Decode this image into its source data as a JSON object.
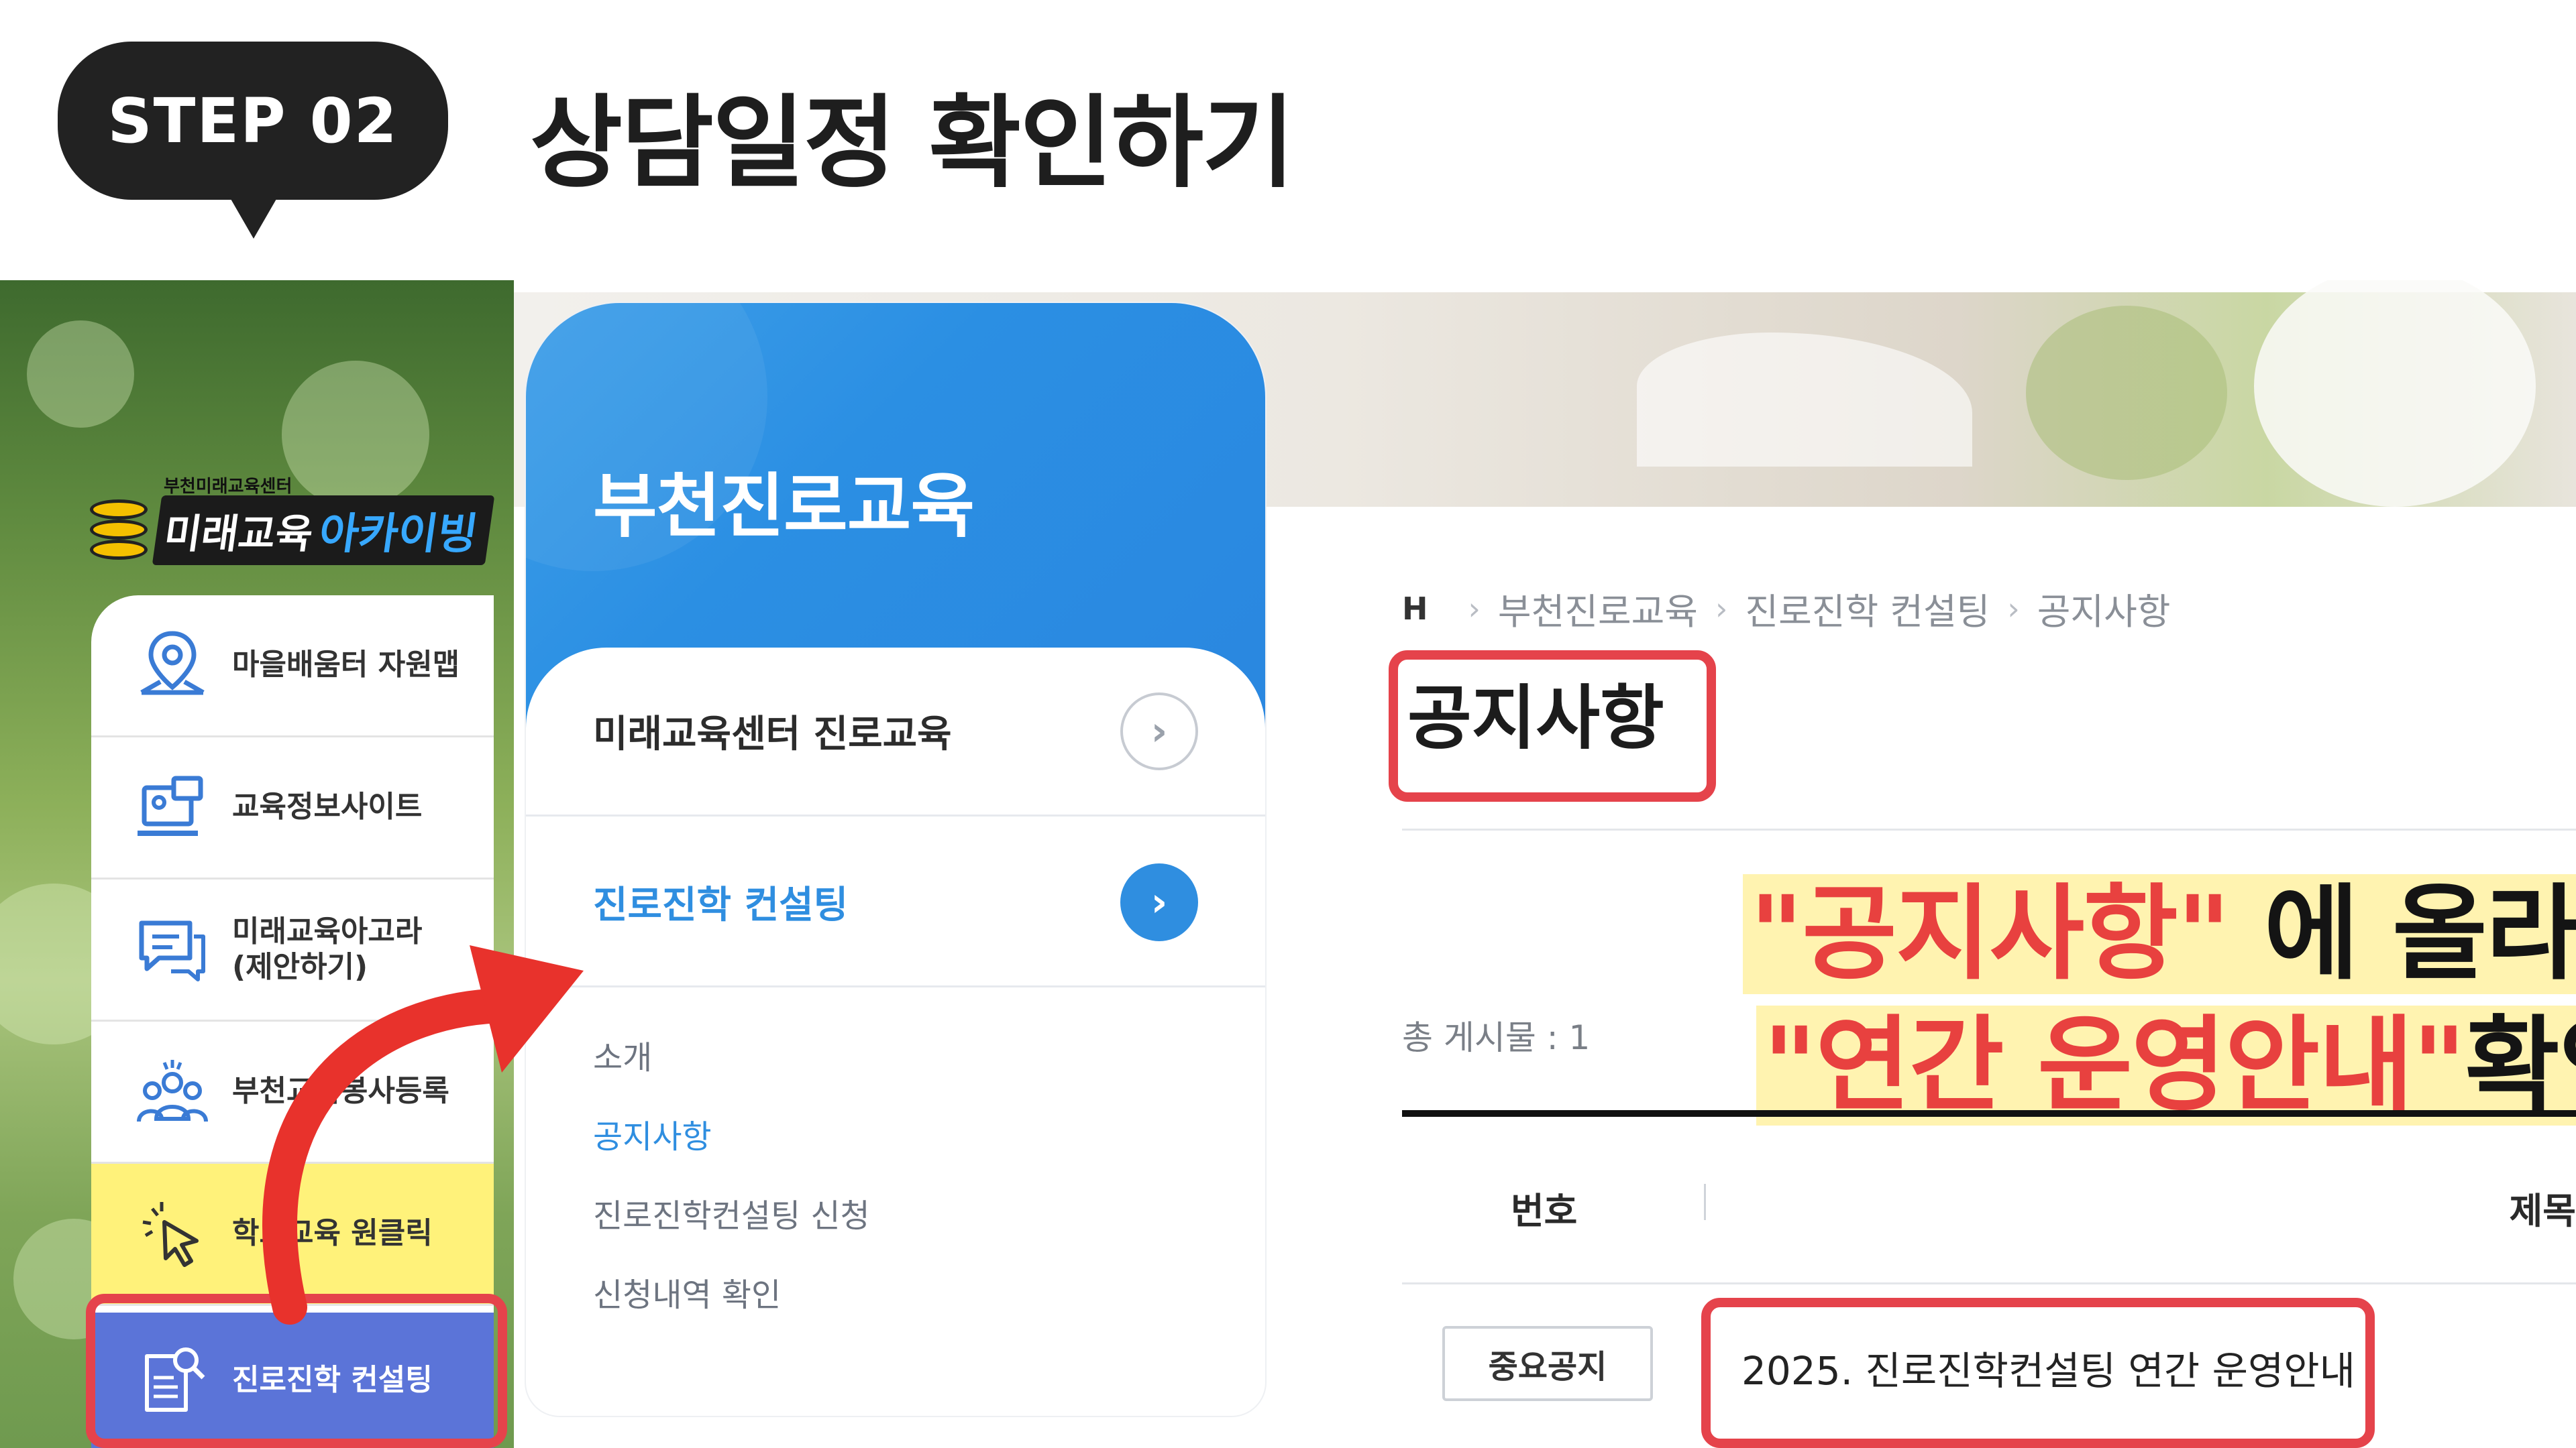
{
  "header": {
    "step_label": "STEP 02",
    "title": "상담일정 확인하기"
  },
  "left_menu": {
    "logo_small": "부천미래교육센터",
    "logo_main_1": "미래교육",
    "logo_main_2": "아카이빙",
    "items": [
      {
        "label": "마을배움터 자원맵",
        "icon": "map-pin-icon"
      },
      {
        "label": "교육정보사이트",
        "icon": "computer-icon"
      },
      {
        "label": "미래교육아고라\n(제안하기)",
        "icon": "chat-bubble-icon"
      },
      {
        "label": "부천교육봉사등록",
        "icon": "people-group-icon"
      },
      {
        "label": "학교교육 원클릭",
        "icon": "click-cursor-icon"
      },
      {
        "label": "진로진학 컨설팅",
        "icon": "document-search-icon"
      }
    ]
  },
  "side_nav": {
    "title": "부천진로교육",
    "rows": [
      {
        "label": "미래교육센터 진로교육"
      },
      {
        "label": "진로진학 컨설팅"
      }
    ],
    "sub_items": [
      "소개",
      "공지사항",
      "진로진학컨설팅 신청",
      "신청내역 확인"
    ]
  },
  "content": {
    "breadcrumb": [
      "부천진로교육",
      "진로진학 컨설팅",
      "공지사항"
    ],
    "title": "공지사항",
    "count_text": "총 게시물 : 1",
    "callout": {
      "line1_red": "\"공지사항\"",
      "line1_dark": " 에 올라온",
      "line2_red": "\"연간 운영안내\"",
      "line2_dark": "확인"
    },
    "table": {
      "col_num": "번호",
      "col_title": "제목",
      "rows": [
        {
          "badge": "중요공지",
          "title": "2025. 진로진학컨설팅 연간 운영안내"
        }
      ]
    }
  },
  "colors": {
    "accent_blue": "#2f8ee0",
    "highlight_red": "#e5434b",
    "callout_red": "#e8413f",
    "active_menu": "#5b74d8"
  }
}
